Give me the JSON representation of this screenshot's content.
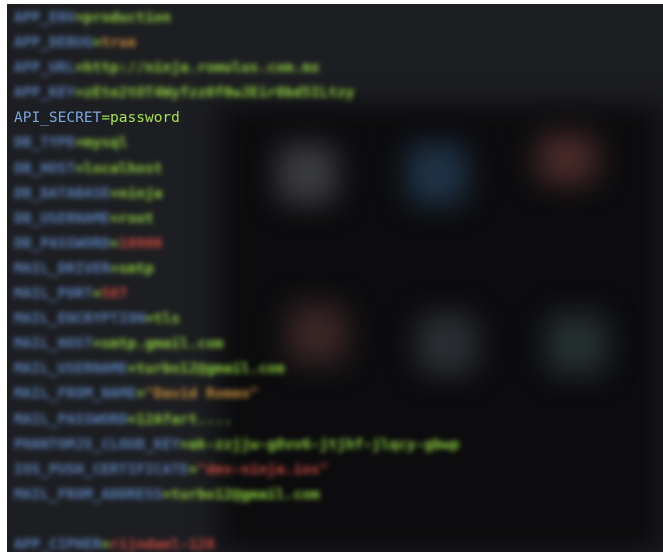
{
  "env_lines": [
    {
      "key": "APP_ENV",
      "value": "production",
      "focused": false,
      "color": "green"
    },
    {
      "key": "APP_DEBUG",
      "value": "true",
      "focused": false,
      "color": "orange"
    },
    {
      "key": "APP_URL",
      "value": "http://ninja.romulus.com.mx",
      "focused": false,
      "color": "green"
    },
    {
      "key": "APP_KEY",
      "value": "zEte2tOT4Wyfzz0f0wJEir0bd5ILtzy",
      "focused": false,
      "color": "green"
    },
    {
      "key": "API_SECRET",
      "value": "password",
      "focused": true,
      "color": "green"
    },
    {
      "key": "DB_TYPE",
      "value": "mysql",
      "focused": false,
      "color": "green"
    },
    {
      "key": "DB_HOST",
      "value": "localhost",
      "focused": false,
      "color": "green"
    },
    {
      "key": "DB_DATABASE",
      "value": "ninja",
      "focused": false,
      "color": "green"
    },
    {
      "key": "DB_USERNAME",
      "value": "root",
      "focused": false,
      "color": "green"
    },
    {
      "key": "DB_PASSWORD",
      "value": "10900",
      "focused": false,
      "color": "red"
    },
    {
      "key": "MAIL_DRIVER",
      "value": "smtp",
      "focused": false,
      "color": "green"
    },
    {
      "key": "MAIL_PORT",
      "value": "587",
      "focused": false,
      "color": "red"
    },
    {
      "key": "MAIL_ENCRYPTION",
      "value": "tls",
      "focused": false,
      "color": "green"
    },
    {
      "key": "MAIL_HOST",
      "value": "smtp.gmail.com",
      "focused": false,
      "color": "green"
    },
    {
      "key": "MAIL_USERNAME",
      "value": "turbo12@gmail.com",
      "focused": false,
      "color": "green"
    },
    {
      "key": "MAIL_FROM_NAME",
      "value": "\"David Romeo\"",
      "focused": false,
      "color": "orange"
    },
    {
      "key": "MAIL_PASSWORD",
      "value": "12Afart....",
      "focused": false,
      "color": "green"
    },
    {
      "key": "PHANTOMJS_CLOUD_KEY",
      "value": "ak-zzjjw-g8vv6-jtjhf-jlqcy-gbwp",
      "focused": false,
      "color": "green"
    },
    {
      "key": "IOS_PUSH_CERTIFICATE",
      "value": "\"dev-ninja.ios\"",
      "focused": false,
      "color": "red"
    },
    {
      "key": "MAIL_FROM_ADDRESS",
      "value": "turbo12@gmail.com",
      "focused": false,
      "color": "green"
    },
    {
      "key": "",
      "value": "",
      "focused": false,
      "color": "green"
    },
    {
      "key": "APP_CIPHER",
      "value": "rijndael-128",
      "focused": false,
      "color": "red"
    }
  ],
  "colors": {
    "background": "#1d1e22",
    "key": "#79a7e0",
    "value": "#a6e34f",
    "value_red": "#c9493f",
    "value_orange": "#c98e3f"
  }
}
